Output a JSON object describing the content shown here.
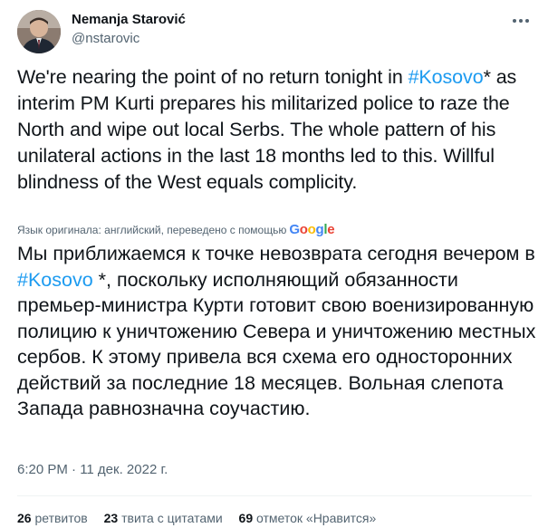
{
  "author": {
    "name": "Nemanja Starović",
    "handle": "@nstarovic"
  },
  "tweet": {
    "en_part1": "We're nearing the point of no return tonight in ",
    "en_hashtag": "#Kosovo",
    "en_part2": "* as interim PM Kurti prepares his militarized police to raze the North and wipe out local Serbs. The whole pattern of his unilateral actions in the last 18 months led to this. Willful blindness of the West equals complicity.",
    "translation_note": "Язык оригинала: английский, переведено с помощью",
    "translation_provider": "Google",
    "ru_part1": "Мы приближаемся к точке невозврата сегодня вечером в ",
    "ru_hashtag": "#Kosovo",
    "ru_part2": " *, поскольку исполняющий обязанности премьер-министра Курти готовит свою военизированную полицию к уничтожению Севера и уничтожению местных сербов. К этому привела вся схема его односторонних действий за последние 18 месяцев. Вольная слепота Запада равнозначна соучастию.",
    "timestamp": "6:20 PM · 11 дек. 2022 г."
  },
  "stats": {
    "retweets_count": "26",
    "retweets_label": "ретвитов",
    "quotes_count": "23",
    "quotes_label": "твита с цитатами",
    "likes_count": "69",
    "likes_label": "отметок «Нравится»"
  },
  "icons": {
    "more": "more-dots-icon"
  },
  "colors": {
    "link": "#1d9bf0",
    "secondary_text": "#536471",
    "primary_text": "#0f1419"
  }
}
